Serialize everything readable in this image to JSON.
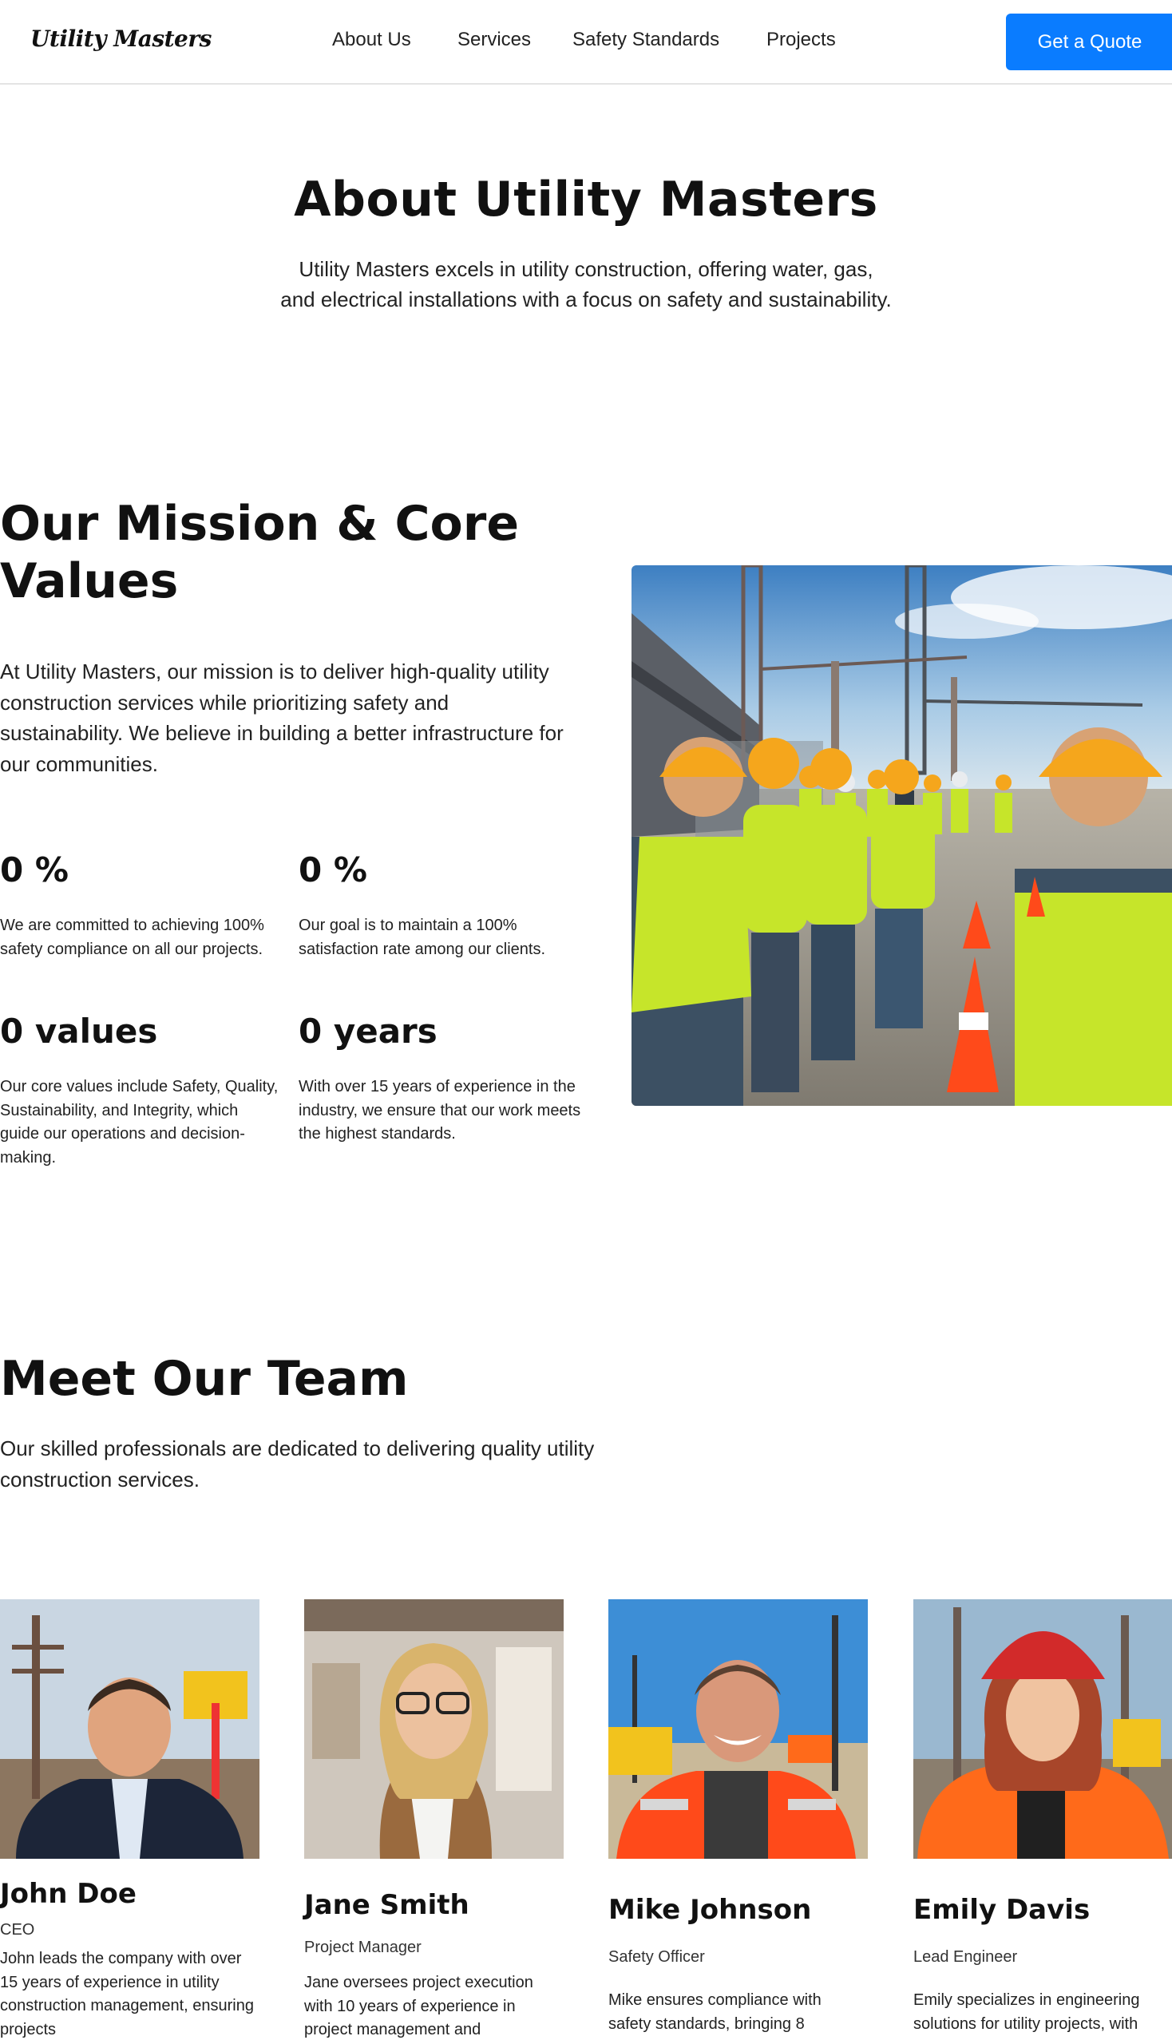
{
  "nav": {
    "logo": "Utility Masters",
    "links": [
      "About Us",
      "Services",
      "Safety Standards",
      "Projects"
    ],
    "cta": "Get a Quote"
  },
  "about": {
    "title": "About Utility Masters",
    "line1": "Utility Masters excels in utility construction, offering water, gas,",
    "line2": "and electrical installations with a focus on safety and sustainability."
  },
  "mission": {
    "title": "Our Mission & Core Values",
    "text": "At Utility Masters, our mission is to deliver high-quality utility construction services while prioritizing safety and sustainability. We believe in building a better infrastructure for our communities.",
    "stats": [
      {
        "value": "0 %",
        "desc": "We are committed to achieving 100% safety compliance on all our projects."
      },
      {
        "value": "0 %",
        "desc": "Our goal is to maintain a 100% satisfaction rate among our clients."
      },
      {
        "value": "0 values",
        "desc": "Our core values include Safety, Quality, Sustainability, and Integrity, which guide our operations and decision-making."
      },
      {
        "value": "0 years",
        "desc": "With over 15 years of experience in the industry, we ensure that our work meets the highest standards."
      }
    ]
  },
  "team": {
    "title": "Meet Our Team",
    "text": "Our skilled professionals are dedicated to delivering quality utility construction services.",
    "members": [
      {
        "name": "John Doe",
        "role": "CEO",
        "bio": "John leads the company with over 15 years of experience in utility construction management, ensuring projects"
      },
      {
        "name": "Jane Smith",
        "role": "Project Manager",
        "bio": "Jane oversees project execution with 10 years of experience in project management and"
      },
      {
        "name": "Mike Johnson",
        "role": "Safety Officer",
        "bio": "Mike ensures compliance with safety standards, bringing 8"
      },
      {
        "name": "Emily Davis",
        "role": "Lead Engineer",
        "bio": "Emily specializes in engineering solutions for utility projects, with"
      }
    ]
  },
  "colors": {
    "accent": "#0a7cff",
    "vest": "#c6e52a",
    "hardhat": "#f5a61c",
    "cone": "#ff4a1a"
  }
}
